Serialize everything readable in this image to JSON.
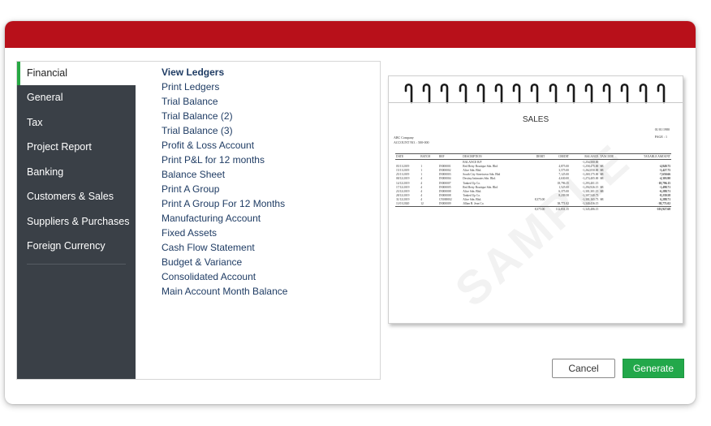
{
  "header": {
    "color": "#b8101a"
  },
  "sidebar": {
    "items": [
      {
        "label": "Financial",
        "active": true
      },
      {
        "label": "General"
      },
      {
        "label": "Tax"
      },
      {
        "label": "Project Report"
      },
      {
        "label": "Banking"
      },
      {
        "label": "Customers & Sales"
      },
      {
        "label": "Suppliers & Purchases"
      },
      {
        "label": "Foreign Currency"
      }
    ]
  },
  "reports": [
    "View Ledgers",
    "Print Ledgers",
    "Trial Balance",
    "Trial Balance (2)",
    "Trial Balance (3)",
    "Profit & Loss Account",
    "Print P&L for 12 months",
    "Balance Sheet",
    "Print A Group",
    "Print A Group For 12 Months",
    "Manufacturing Account",
    "Fixed Assets",
    "Cash Flow Statement",
    "Budget & Variance",
    "Consolidated Account",
    "Main Account Month Balance"
  ],
  "preview": {
    "title": "SALES",
    "watermark": "SAMPLE",
    "company": "ABC Company",
    "account_no": "ACCOUNT NO. : 500-000",
    "date": "01/01/1980",
    "page": "PAGE : 1",
    "columns": [
      "DATE",
      "BATCH",
      "REF",
      "DESCRIPTION",
      "DEBIT",
      "CREDIT",
      "BALANCE",
      "TAXCODE",
      "TAXABLE AMOUNT"
    ],
    "rows": [
      [
        "",
        "",
        "",
        "BALANCE B/F",
        "",
        "",
        "-1,254,500.00",
        "",
        ""
      ],
      [
        "05/11/2019",
        "1",
        "IN000001",
        "Red Betty Boutique Sdn. Bhd",
        "",
        "4,875.00",
        "-1,258,475.00",
        "SR",
        "-4,849.75"
      ],
      [
        "15/11/2019",
        "1",
        "IN000002",
        "Alice Sdn. Bhd.",
        "",
        "3,575.00",
        "-1,262,050.00",
        "SR",
        "-3,427.75"
      ],
      [
        "25/11/2019",
        "1",
        "IN000003",
        "South City Streetwear Sdn. Bhd",
        "",
        "7,125.00",
        "-1,269,175.00",
        "SR",
        "-7,650.66"
      ],
      [
        "08/12/2019",
        "4",
        "IN000004",
        "Destiny Intimates Sdn. Bhd.",
        "",
        "4,630.00",
        "-1,274,405.00",
        "SR",
        "-4,303.90"
      ],
      [
        "14/12/2019",
        "4",
        "IN000007",
        "Tanked Up Co.",
        "",
        "18,796.15",
        "-1,293,401.15",
        "",
        "-18,796.15"
      ],
      [
        "17/12/2019",
        "4",
        "IN000005",
        "Red Betty Boutique Sdn. Bhd",
        "",
        "1,525.00",
        "-1,294,926.15",
        "SR",
        "-1,498.71"
      ],
      [
        "23/12/2019",
        "4",
        "IN000008",
        "Alice Sdn. Bhd.",
        "",
        "6,375.00",
        "-1,301,301.15",
        "SR",
        "-6,288.71"
      ],
      [
        "28/12/2019",
        "4",
        "IN000008",
        "Tanked Up Co.",
        "",
        "8,239.58",
        "-1,307,540.73",
        "",
        "-8,239.58"
      ],
      [
        "31/12/2019",
        "4",
        "CN000002",
        "Alice Sdn. Bhd.",
        "8,375.00",
        "",
        "-1,301,165.73",
        "SR",
        "6,288.71"
      ],
      [
        "11/01/2020",
        "12",
        "IN000009",
        "Jillian B. Jean Co.",
        "",
        "38,771.02",
        "-1,340,436.15",
        "",
        "-38,771.02"
      ]
    ],
    "totals": [
      "",
      "",
      "",
      "",
      "8,375.00",
      "112,831.15",
      "-1,345,486.15",
      "",
      "-101,927.68"
    ]
  },
  "buttons": {
    "cancel": "Cancel",
    "generate": "Generate"
  }
}
